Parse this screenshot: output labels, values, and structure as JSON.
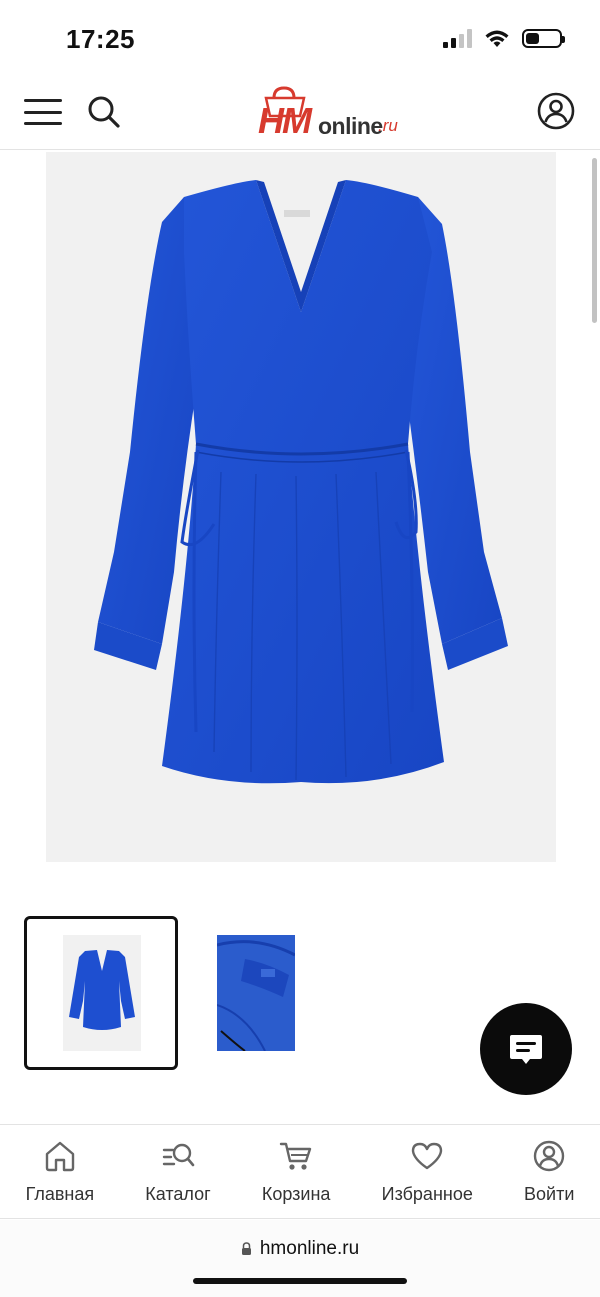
{
  "status_bar": {
    "time": "17:25",
    "icons": [
      "signal-icon",
      "wifi-icon",
      "battery-icon"
    ]
  },
  "header": {
    "logo": {
      "brand": "HM",
      "name": "online",
      "tld": ".ru"
    },
    "icons": [
      "menu-icon",
      "search-icon",
      "account-icon"
    ],
    "colors": {
      "brand_red": "#d73a2e"
    }
  },
  "product": {
    "images": [
      "dress-front",
      "dress-detail"
    ],
    "color": "#1e4fd0",
    "selected_image_index": 0
  },
  "chat": {
    "icon": "chat-icon"
  },
  "bottom_nav": {
    "items": [
      {
        "label": "Главная",
        "icon": "home-icon"
      },
      {
        "label": "Каталог",
        "icon": "catalog-search-icon"
      },
      {
        "label": "Корзина",
        "icon": "cart-icon"
      },
      {
        "label": "Избранное",
        "icon": "heart-icon"
      },
      {
        "label": "Войти",
        "icon": "user-icon"
      }
    ]
  },
  "browser": {
    "url": "hmonline.ru"
  }
}
